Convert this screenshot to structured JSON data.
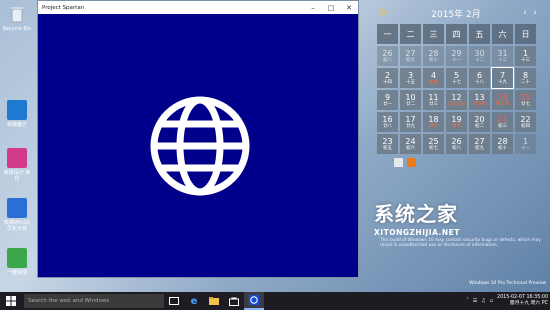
{
  "desktop": {
    "icons": [
      {
        "label": "Recycle Bin",
        "icon": "recycle-bin-icon",
        "color": "#e8eef5"
      },
      {
        "label": "软媒魔方",
        "icon": "app-cube-icon",
        "color": "#1f78d1"
      },
      {
        "label": "软媒设计 美化",
        "icon": "app-theme-icon",
        "color": "#d43a8b"
      },
      {
        "label": "软媒Win10 优化大师",
        "icon": "app-optimizer-icon",
        "color": "#2a6fd6"
      },
      {
        "label": "一键清理",
        "icon": "app-clean-icon",
        "color": "#3aa84a"
      }
    ]
  },
  "window": {
    "title": "Project Spartan",
    "content_color": "#00008b",
    "icon": "globe-icon"
  },
  "calendar": {
    "month_label": "2015年 2月",
    "weekdays": [
      "一",
      "二",
      "三",
      "四",
      "五",
      "六",
      "日"
    ],
    "days": [
      {
        "n": "26",
        "l": "初八",
        "other": true
      },
      {
        "n": "27",
        "l": "初九",
        "other": true
      },
      {
        "n": "28",
        "l": "初十",
        "other": true
      },
      {
        "n": "29",
        "l": "十一",
        "other": true
      },
      {
        "n": "30",
        "l": "十二",
        "other": true
      },
      {
        "n": "31",
        "l": "十三",
        "other": true
      },
      {
        "n": "1",
        "l": "十三"
      },
      {
        "n": "2",
        "l": "十四"
      },
      {
        "n": "3",
        "l": "十五"
      },
      {
        "n": "4",
        "l": "立春",
        "hol": true
      },
      {
        "n": "5",
        "l": "十七"
      },
      {
        "n": "6",
        "l": "十八"
      },
      {
        "n": "7",
        "l": "十九",
        "today": true
      },
      {
        "n": "8",
        "l": "二十"
      },
      {
        "n": "9",
        "l": "廿一"
      },
      {
        "n": "10",
        "l": "廿二"
      },
      {
        "n": "11",
        "l": "廿三"
      },
      {
        "n": "12",
        "l": "小年(北)",
        "hol": true
      },
      {
        "n": "13",
        "l": "小年(南)",
        "hol": true
      },
      {
        "n": "14",
        "l": "情人节",
        "hol": true,
        "wknd": true
      },
      {
        "n": "15",
        "l": "廿七",
        "wknd": true
      },
      {
        "n": "16",
        "l": "廿八"
      },
      {
        "n": "17",
        "l": "廿九"
      },
      {
        "n": "18",
        "l": "除夕",
        "hol": true
      },
      {
        "n": "19",
        "l": "春节",
        "hol": true
      },
      {
        "n": "20",
        "l": "初二"
      },
      {
        "n": "21",
        "l": "初三",
        "wknd": true
      },
      {
        "n": "22",
        "l": "初四"
      },
      {
        "n": "23",
        "l": "初五"
      },
      {
        "n": "24",
        "l": "初六"
      },
      {
        "n": "25",
        "l": "初七"
      },
      {
        "n": "26",
        "l": "初八"
      },
      {
        "n": "27",
        "l": "初九"
      },
      {
        "n": "28",
        "l": "初十"
      },
      {
        "n": "1",
        "l": "十一",
        "other": true
      }
    ]
  },
  "watermark": {
    "title": "系统之家",
    "url": "XITONGZHIJIA.NET"
  },
  "legal_text": "This build of Windows 10 may contain security bugs or defects, which may result in unauthorized use or disclosure of information.",
  "preview_label": "Windows 10 Pro Technical Preview",
  "taskbar": {
    "search_placeholder": "Search the web and Windows",
    "clock_time": "2015-02-07  16:35:00",
    "clock_date": "腊月十九  周六 PC"
  }
}
